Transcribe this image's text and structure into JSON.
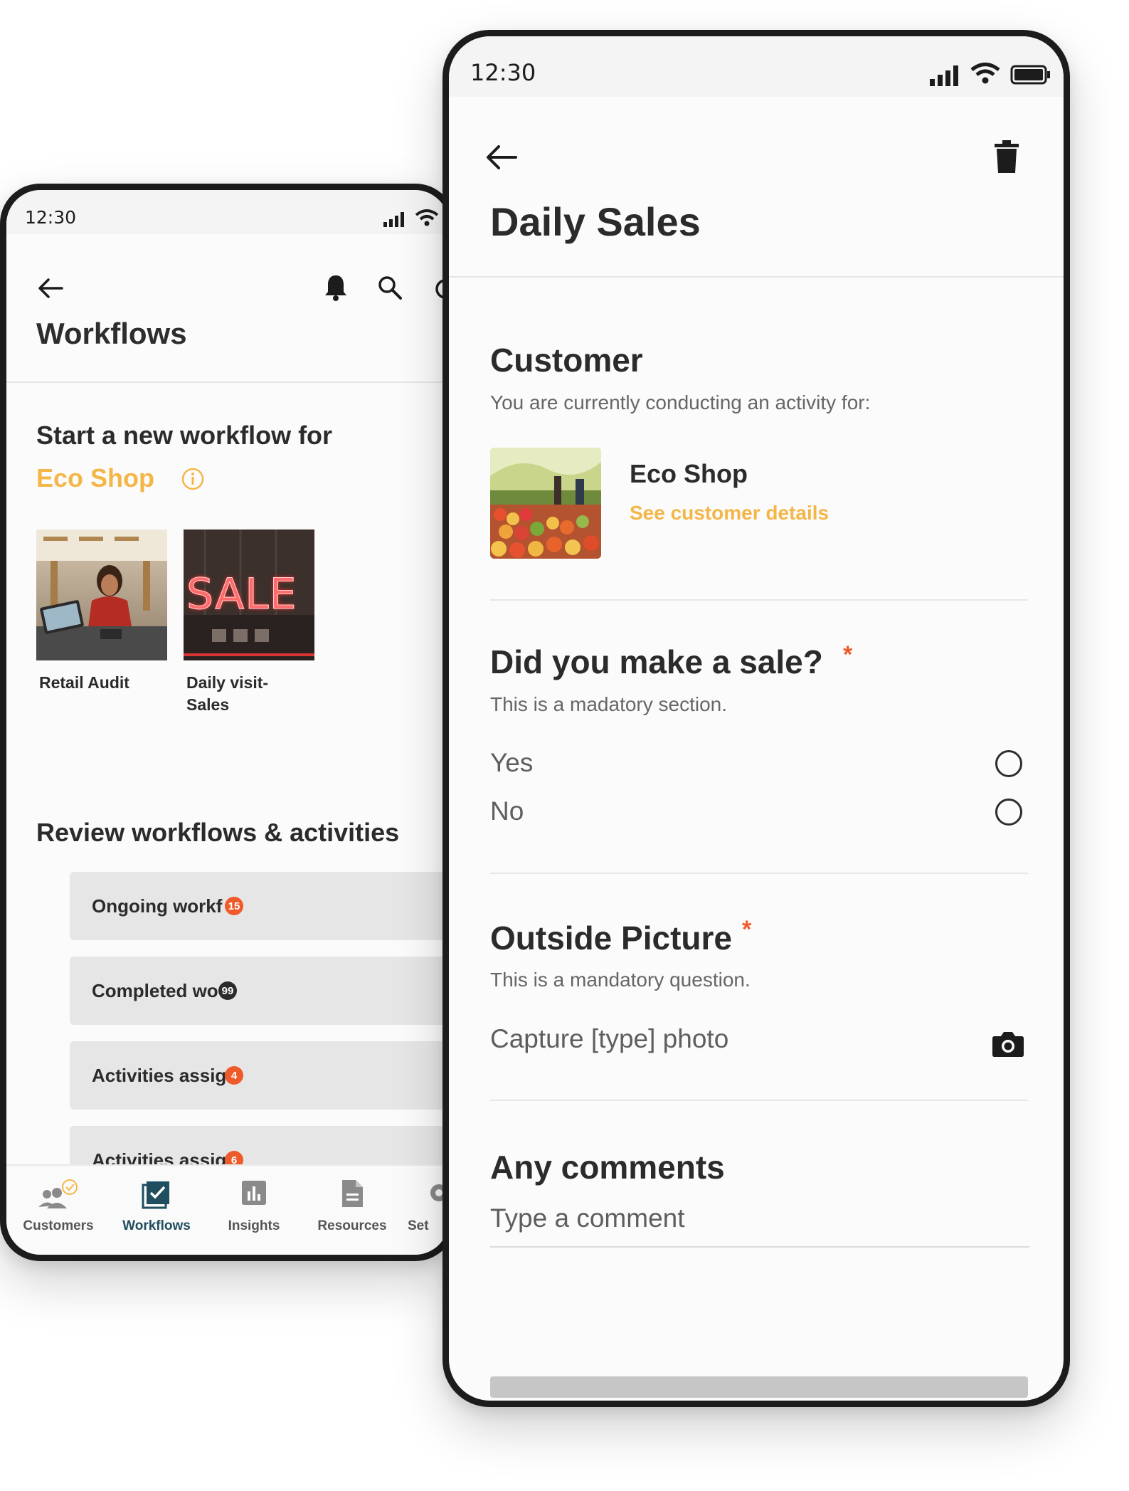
{
  "left_phone": {
    "status": {
      "time": "12:30"
    },
    "header": {
      "title": "Workflows"
    },
    "start": {
      "heading": "Start a new workflow for",
      "customer_name": "Eco Shop",
      "tiles": [
        {
          "label": "Retail Audit"
        },
        {
          "label_line1": "Daily visit-",
          "label_line2": "Sales",
          "image_text": "SALE"
        }
      ]
    },
    "review": {
      "heading": "Review workflows & activities",
      "items": [
        {
          "label": "Ongoing workf",
          "count": "15",
          "badge_color": "#ef5a2a"
        },
        {
          "label": "Completed wo",
          "count": "99",
          "badge_color": "#2b2b2b"
        },
        {
          "label": "Activities assig",
          "count": "4",
          "badge_color": "#ef5a2a"
        },
        {
          "label": "Activities assig",
          "count": "6",
          "badge_color": "#ef5a2a"
        }
      ]
    },
    "nav": [
      {
        "label": "Customers",
        "icon": "people-icon"
      },
      {
        "label": "Workflows",
        "icon": "workflow-check-icon",
        "active": true
      },
      {
        "label": "Insights",
        "icon": "bar-chart-icon"
      },
      {
        "label": "Resources",
        "icon": "document-icon"
      },
      {
        "label": "Set",
        "icon": "gear-icon"
      }
    ]
  },
  "right_phone": {
    "status": {
      "time": "12:30"
    },
    "header": {
      "title": "Daily Sales"
    },
    "customer": {
      "heading": "Customer",
      "subtitle": "You are currently conducting an activity for:",
      "name": "Eco Shop",
      "link": "See customer details"
    },
    "sale_question": {
      "heading": "Did you make a sale?",
      "required_mark": "*",
      "subtitle": "This is a madatory section.",
      "options": [
        "Yes",
        "No"
      ]
    },
    "picture_question": {
      "heading": "Outside Picture",
      "required_mark": "*",
      "subtitle": "This is a mandatory question.",
      "capture_label": "Capture [type] photo"
    },
    "comments": {
      "heading": "Any comments",
      "placeholder": "Type a comment"
    }
  },
  "colors": {
    "accent_yellow": "#f5b648",
    "accent_orange": "#ef5a2a",
    "nav_active": "#1f4e5f",
    "text_dark": "#2b2b2b"
  }
}
